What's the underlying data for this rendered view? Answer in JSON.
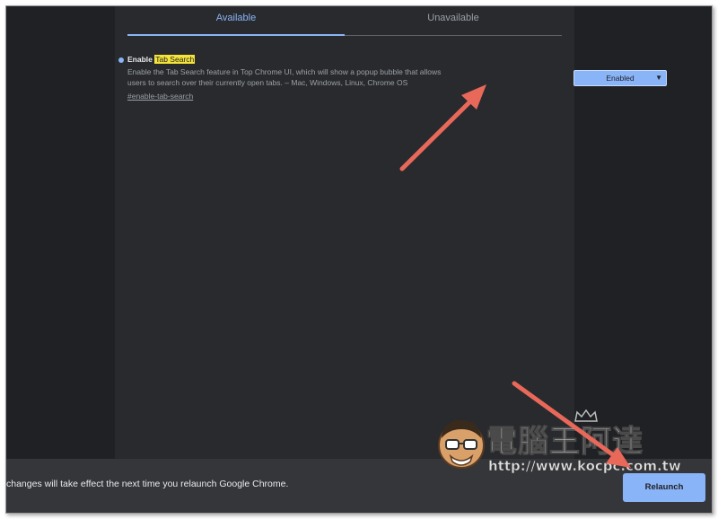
{
  "tabs": [
    {
      "label": "Available",
      "active": true
    },
    {
      "label": "Unavailable",
      "active": false
    }
  ],
  "experiment": {
    "title_prefix": "Enable ",
    "title_highlight": "Tab Search",
    "description": "Enable the Tab Search feature in Top Chrome UI, which will show a popup bubble that allows users to search over their currently open tabs. – Mac, Windows, Linux, Chrome OS",
    "link": "#enable-tab-search",
    "select_value": "Enabled"
  },
  "bottom_bar": {
    "message": "changes will take effect the next time you relaunch Google Chrome.",
    "relaunch_label": "Relaunch"
  },
  "watermark": {
    "title": "電腦王阿達",
    "url": "http://www.kocpc.com.tw"
  },
  "colors": {
    "accent": "#8ab4f8",
    "background": "#202124",
    "panel": "#292a2d",
    "bottom_bar": "#35363a",
    "highlight": "#f5e43a",
    "annotation_arrow": "#e8685a"
  }
}
